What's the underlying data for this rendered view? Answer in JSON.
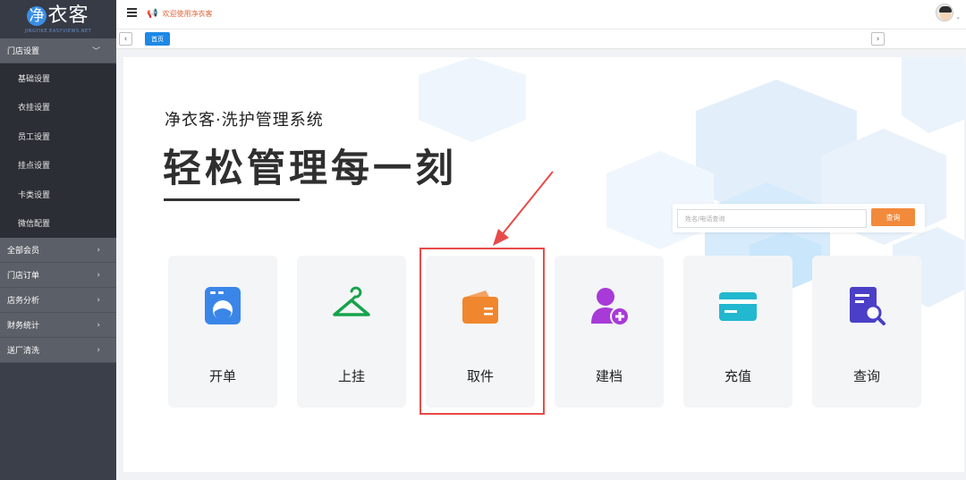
{
  "logo": {
    "mark": "净",
    "text": "衣客",
    "sub": "JINGYIKE.EASYVIEWS.NET"
  },
  "sidebar": {
    "groups": [
      {
        "label": "门店设置",
        "arrow": "﹀",
        "expanded": true
      },
      {
        "label": "全部会员",
        "arrow": "›"
      },
      {
        "label": "门店订单",
        "arrow": "›"
      },
      {
        "label": "店务分析",
        "arrow": "›"
      },
      {
        "label": "财务统计",
        "arrow": "›"
      },
      {
        "label": "送厂清洗",
        "arrow": "›"
      }
    ],
    "subitems": [
      "基础设置",
      "衣挂设置",
      "员工设置",
      "挂点设置",
      "卡类设置",
      "微信配置"
    ]
  },
  "header": {
    "announcement": "欢迎使用净衣客"
  },
  "tabs": {
    "prev": "‹",
    "next": "›",
    "home": "首页"
  },
  "hero": {
    "subtitle": "净衣客·洗护管理系统",
    "headline": "轻松管理每一刻"
  },
  "search": {
    "placeholder": "姓名/电话查询",
    "button": "查询"
  },
  "cards": [
    {
      "label": "开单",
      "icon": "washing-machine-icon",
      "color": "#3a86e8"
    },
    {
      "label": "上挂",
      "icon": "hanger-icon",
      "color": "#16a34a"
    },
    {
      "label": "取件",
      "icon": "wallet-icon",
      "color": "#f0872e"
    },
    {
      "label": "建档",
      "icon": "add-user-icon",
      "color": "#a83ad8"
    },
    {
      "label": "充值",
      "icon": "card-icon",
      "color": "#22b8cf"
    },
    {
      "label": "查询",
      "icon": "search-document-icon",
      "color": "#4b3fc7"
    }
  ],
  "colors": {
    "highlight": "#e84a4a",
    "sidebar": "#3b3f4a",
    "accent": "#1e88e5",
    "search_button": "#f28a3b"
  }
}
